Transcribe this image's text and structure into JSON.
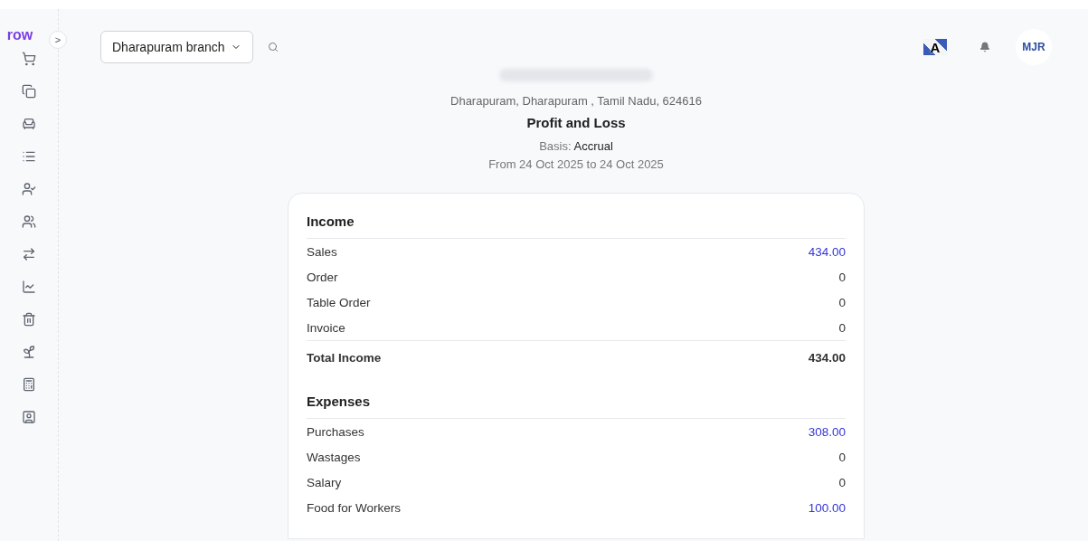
{
  "sidebar": {
    "logo": "row",
    "expand_icon": ">"
  },
  "header": {
    "branch": "Dharapuram branch",
    "language": "A",
    "avatar": "MJR"
  },
  "report": {
    "address": "Dharapuram, Dharapuram , Tamil Nadu, 624616",
    "title": "Profit and Loss",
    "basis_label": "Basis:",
    "basis": "Accrual",
    "period": "From 24 Oct 2025 to 24 Oct 2025"
  },
  "sections": [
    {
      "title": "Income",
      "rows": [
        {
          "label": "Sales",
          "value": "434.00",
          "linked": true
        },
        {
          "label": "Order",
          "value": "0",
          "linked": false
        },
        {
          "label": "Table Order",
          "value": "0",
          "linked": false
        },
        {
          "label": "Invoice",
          "value": "0",
          "linked": false
        }
      ],
      "total": {
        "label": "Total Income",
        "value": "434.00"
      }
    },
    {
      "title": "Expenses",
      "rows": [
        {
          "label": "Purchases",
          "value": "308.00",
          "linked": true
        },
        {
          "label": "Wastages",
          "value": "0",
          "linked": false
        },
        {
          "label": "Salary",
          "value": "0",
          "linked": false
        },
        {
          "label": "Food for Workers",
          "value": "100.00",
          "linked": true
        }
      ]
    }
  ]
}
